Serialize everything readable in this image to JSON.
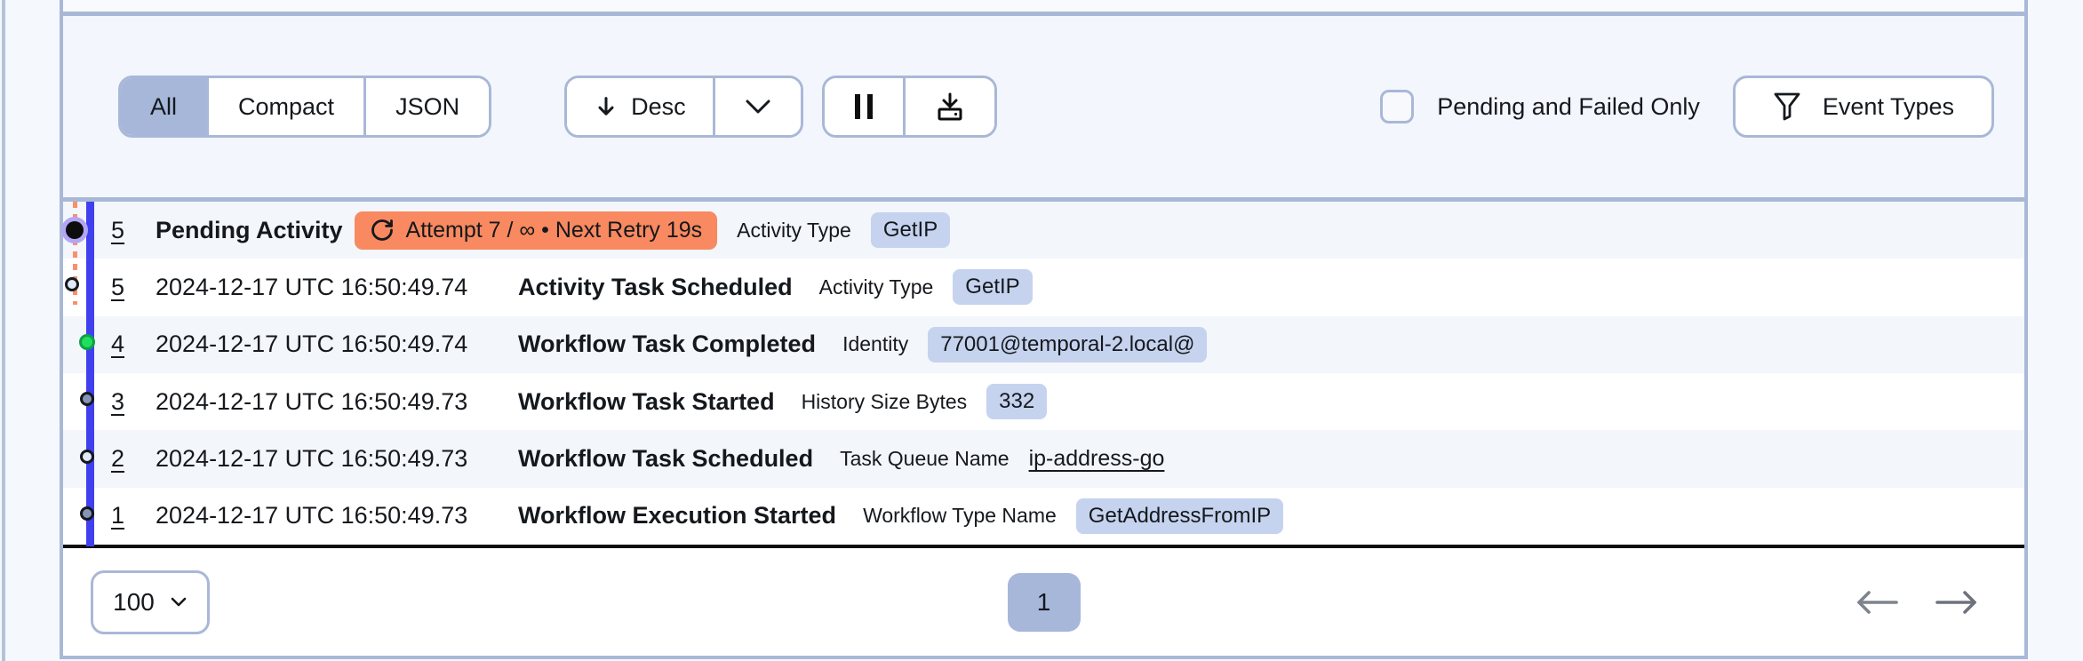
{
  "toolbar": {
    "view_tabs": {
      "options": [
        "All",
        "Compact",
        "JSON"
      ],
      "active": "All"
    },
    "sort": {
      "label": "Desc",
      "direction": "descending"
    },
    "icon_buttons": [
      "pause-icon",
      "download-icon"
    ],
    "pending_failed_checkbox": {
      "label": "Pending and Failed Only",
      "checked": false
    },
    "event_types_button": {
      "label": "Event Types",
      "icon": "funnel-icon"
    }
  },
  "events": [
    {
      "id": "5",
      "timestamp": "",
      "title": "Pending Activity",
      "retry_badge": "Attempt 7 / ∞ • Next Retry 19s",
      "attr_label": "Activity Type",
      "attr_value": "GetIP",
      "marker": "pending-black-purple"
    },
    {
      "id": "5",
      "timestamp": "2024-12-17 UTC 16:50:49.74",
      "title": "Activity Task Scheduled",
      "attr_label": "Activity Type",
      "attr_value": "GetIP",
      "marker": "light-blue"
    },
    {
      "id": "4",
      "timestamp": "2024-12-17 UTC 16:50:49.74",
      "title": "Workflow Task Completed",
      "attr_label": "Identity",
      "attr_value": "77001@temporal-2.local@",
      "marker": "green"
    },
    {
      "id": "3",
      "timestamp": "2024-12-17 UTC 16:50:49.73",
      "title": "Workflow Task Started",
      "attr_label": "History Size Bytes",
      "attr_value": "332",
      "marker": "slate"
    },
    {
      "id": "2",
      "timestamp": "2024-12-17 UTC 16:50:49.73",
      "title": "Workflow Task Scheduled",
      "attr_label": "Task Queue Name",
      "attr_value": "ip-address-go",
      "marker": "light-blue"
    },
    {
      "id": "1",
      "timestamp": "2024-12-17 UTC 16:50:49.73",
      "title": "Workflow Execution Started",
      "attr_label": "Workflow Type Name",
      "attr_value": "GetAddressFromIP",
      "marker": "slate"
    }
  ],
  "pagination": {
    "page_size": "100",
    "current_page": "1"
  },
  "colors": {
    "panel_border": "#a9b8d6",
    "active_segment": "#a6b7da",
    "value_badge_bg": "#c5d3ef",
    "retry_badge_bg": "#f88960",
    "timeline_blue": "#4040ef",
    "green_dot": "#20df5b",
    "slate_dot": "#8595b6",
    "light_dot": "#e3e9f8"
  }
}
